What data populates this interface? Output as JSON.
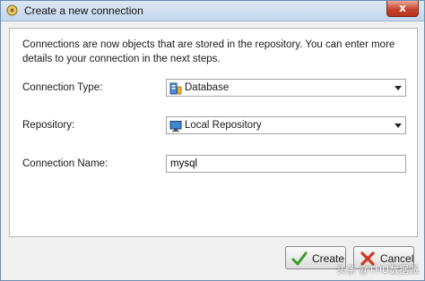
{
  "window": {
    "title": "Create a new connection",
    "close_label": "x"
  },
  "description": "Connections are now objects that are stored in the repository. You can enter more details to your connection in the next steps.",
  "form": {
    "connection_type": {
      "label": "Connection Type:",
      "value": "Database",
      "icon": "database-icon"
    },
    "repository": {
      "label": "Repository:",
      "value": "Local Repository",
      "icon": "monitor-icon"
    },
    "connection_name": {
      "label": "Connection Name:",
      "value": "mysql"
    }
  },
  "buttons": {
    "create": {
      "label": "Create",
      "icon": "checkmark-icon",
      "color": "#3f9d2a"
    },
    "cancel": {
      "label": "Cancel",
      "icon": "x-mark-icon",
      "color": "#d6361f"
    }
  },
  "watermark": "头条 @THU数据派"
}
